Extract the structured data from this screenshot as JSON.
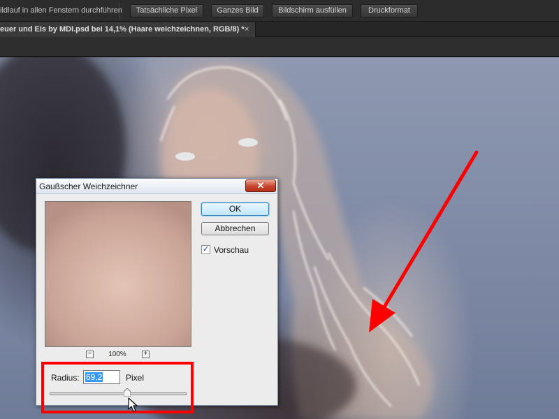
{
  "options_bar": {
    "scroll_all_windows": "ildlauf in allen Fenstern durchführen",
    "buttons": [
      "Tatsächliche Pixel",
      "Ganzes Bild",
      "Bildschirm ausfüllen",
      "Druckformat"
    ]
  },
  "document_tab": {
    "title": "euer und Eis by MDI.psd bei 14,1% (Haare weichzeichnen, RGB/8) *",
    "close_glyph": "×"
  },
  "dialog": {
    "title": "Gaußscher Weichzeichner",
    "close_glyph": "✕",
    "ok_label": "OK",
    "cancel_label": "Abbrechen",
    "preview_label": "Vorschau",
    "preview_checked": true,
    "check_glyph": "✓",
    "zoom": "100%",
    "zoom_minus_glyph": "−",
    "zoom_plus_glyph": "+",
    "radius_label": "Radius:",
    "radius_value": "69,2",
    "unit_label": "Pixel",
    "slider_position": 0.6
  },
  "annotations": {
    "color": "#ff0000"
  },
  "icons": [
    "dialog-close-icon",
    "checkbox-check-icon",
    "zoom-minus-icon",
    "zoom-plus-icon",
    "slider-thumb-icon",
    "mouse-pointer-icon",
    "annotation-arrow-icon"
  ]
}
